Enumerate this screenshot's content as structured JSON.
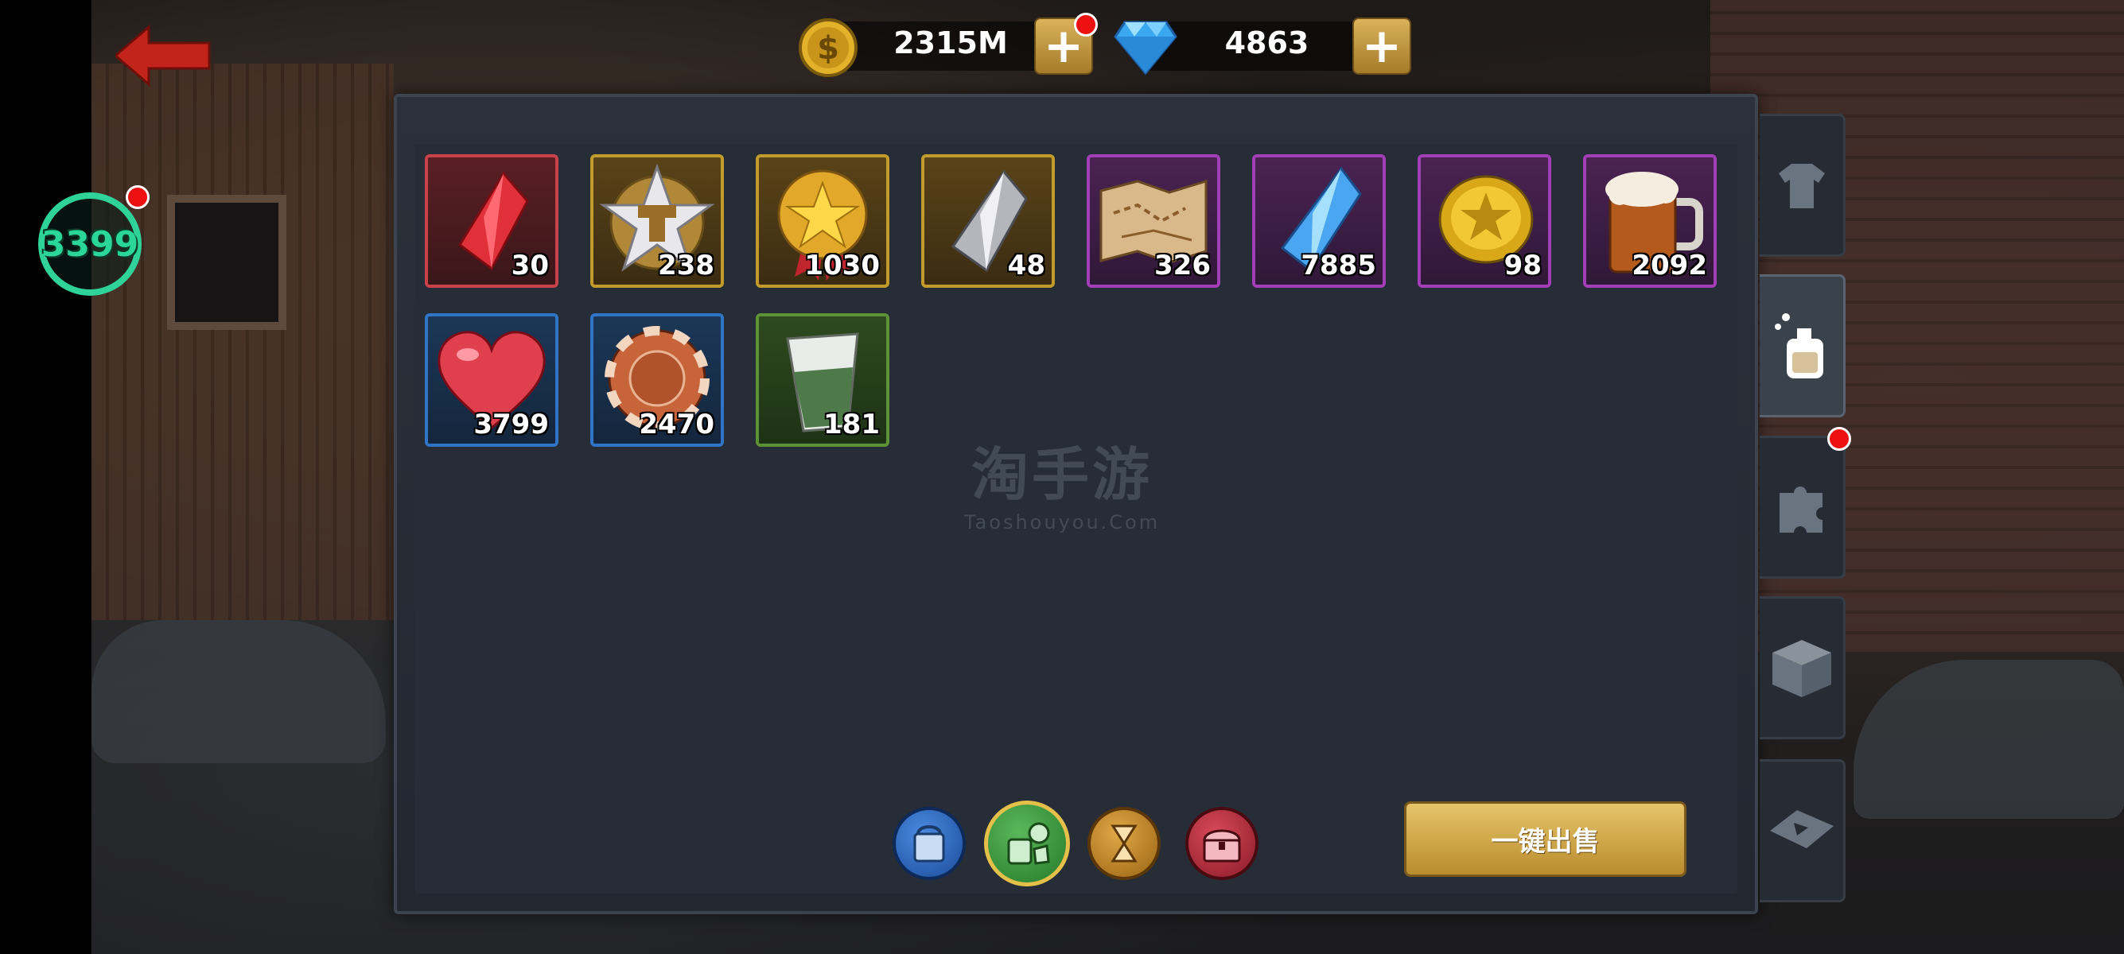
{
  "currency": {
    "gold": "2315M",
    "gems": "4863"
  },
  "level": "3399",
  "items": [
    {
      "name": "red-crystal",
      "qty": "30",
      "rarity": "red"
    },
    {
      "name": "silver-star-medal",
      "qty": "238",
      "rarity": "gold"
    },
    {
      "name": "gold-star-medal",
      "qty": "1030",
      "rarity": "gold"
    },
    {
      "name": "silver-crystal",
      "qty": "48",
      "rarity": "gold"
    },
    {
      "name": "treasure-map",
      "qty": "326",
      "rarity": "purple"
    },
    {
      "name": "blue-crystal",
      "qty": "7885",
      "rarity": "purple"
    },
    {
      "name": "gold-coin",
      "qty": "98",
      "rarity": "purple"
    },
    {
      "name": "beer-mug",
      "qty": "2092",
      "rarity": "purple"
    },
    {
      "name": "heart",
      "qty": "3799",
      "rarity": "blue"
    },
    {
      "name": "poker-chip",
      "qty": "2470",
      "rarity": "blue"
    },
    {
      "name": "shot-glass",
      "qty": "181",
      "rarity": "green"
    }
  ],
  "watermark": {
    "cn": "淘手游",
    "en": "Taoshouyou.Com"
  },
  "sell_all_label": "一键出售",
  "side_tabs": [
    "shirt-icon",
    "potion-icon",
    "puzzle-icon",
    "box-icon",
    "ticket-icon"
  ],
  "colors": {
    "gold_accent": "#d9b25a",
    "level_green": "#2fd39a",
    "notification_red": "#e11111"
  }
}
